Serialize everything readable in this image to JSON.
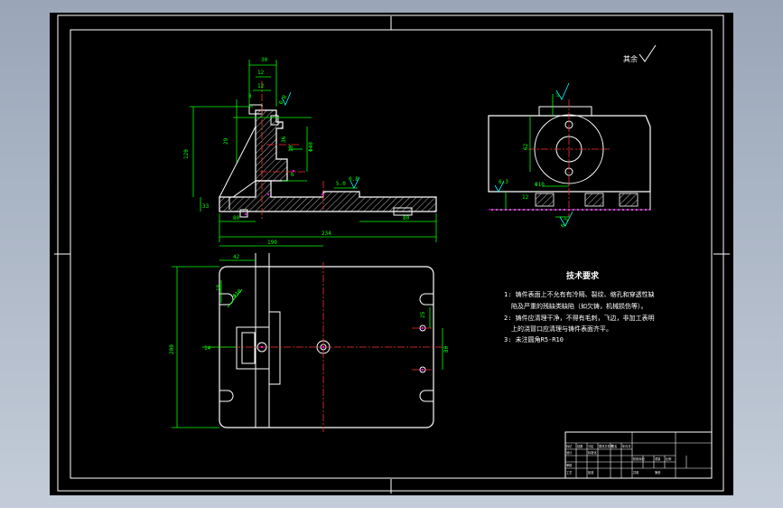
{
  "colors": {
    "background": "#000000",
    "viewport_bg": "#a9b4c4",
    "frame": "#ffffff",
    "dimension": "#00ff00",
    "outline": "#ffffff",
    "hatch": "#ffffff",
    "centerline": "#ff3030",
    "marker": "#ff00ff",
    "symbol": "#00ffff"
  },
  "surface_finish_note": {
    "text": "其余",
    "icon": "surface-roughness-check-icon"
  },
  "tech_requirements": {
    "title": "技术要求",
    "lines": [
      "1: 铸件表面上不允有有冷隔、裂纹、缩孔和穿透性缺",
      "陷及严重的残缺类缺陷（如欠铸，机械损伤等）。",
      "2: 铸件应清理干净，不得有毛刺，飞边，非加工表明",
      "上的浇冒口应清理与铸件表面齐平。",
      "3: 未注圆角R5-R10"
    ]
  },
  "front_view_dims": [
    "30",
    "12",
    "12",
    "8",
    "29",
    "36",
    "0.8",
    "Φ40",
    "6",
    "10",
    "120",
    "33",
    "5.0",
    "0.8",
    "80",
    "80",
    "234"
  ],
  "top_view_dims": [
    "190",
    "42",
    "18",
    "Φ10",
    "14",
    "80",
    "25",
    "200"
  ],
  "side_view_dims": [
    "62",
    "12",
    "Φ10",
    "6.3",
    "6.3"
  ],
  "title_block": {
    "cells": [
      "标记",
      "处数",
      "分区",
      "更改文件号",
      "签名",
      "年月日",
      "设计",
      "标准化",
      "阶段标记",
      "重量",
      "比例",
      "审核",
      "工艺",
      "批准",
      "共张",
      "第张"
    ]
  }
}
